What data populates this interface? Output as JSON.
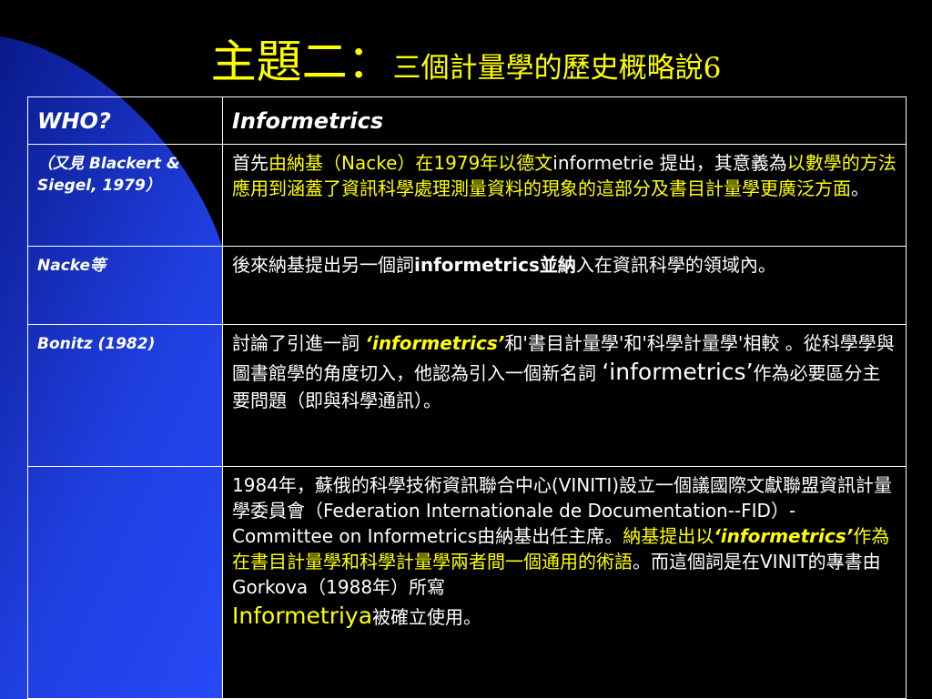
{
  "title": {
    "main": "主題二：",
    "sub": "三個計量學的歷史概略說6"
  },
  "colors": {
    "background": "#000000",
    "title": "#ffff00",
    "highlight": "#ffff00",
    "curve": "#1f3fe0",
    "text": "#ffffff"
  },
  "table": {
    "header": {
      "who": "WHO?",
      "what": "Informetrics"
    },
    "rows": [
      {
        "who": "（又見 Blackert & Siegel, 1979）",
        "desc": {
          "p1": "首先",
          "y1": "由納基（",
          "y2": "Nacke",
          "y3": "）在",
          "w1": "1979",
          "y4": "年以德文",
          "w2": "informetrie",
          "w3": " 提出，其意義為",
          "y5": "以數學的方法應用到涵蓋了資訊科學處理測量資料的現象的這部分及書目計量學更廣泛方面",
          "w4": "。"
        }
      },
      {
        "who": "Nacke等",
        "desc": {
          "p1": "後來納基提出另一個詞",
          "b1": "informetrics並納",
          "p2": "入在資訊科學的領域內。"
        }
      },
      {
        "who": "Bonitz (1982)",
        "desc": {
          "p1": "討論了引進一詞 ",
          "y1": "‘informetrics’",
          "p2": "和'書目計量學'和'科學計量學'相較 。從科學學與圖書館學的角度切入，他認為引入一個新名詞 ",
          "big1": "‘informetrics’",
          "p3": "作為必要區分主要問題（即與科學通訊）。"
        }
      },
      {
        "who": "",
        "desc": {
          "p1": "1984年，蘇俄的科學技術資訊聯合中心(VINITI)設立一個議國際文獻聯盟資訊計量學委員會（Federation Internationale de Documentation--FID）-Committee on Informetrics由納基出任主席。",
          "y1": "納基提出以",
          "y2": "‘informetrics’",
          "y3": "作為在書目計量學和科學計量學兩者間一個通用的術語",
          "p2": "。而這個詞是在VINIT的專書由Gorkova（1988年）所寫",
          "y4": "Informetriya",
          "p3": "被確立使用。"
        }
      }
    ]
  }
}
